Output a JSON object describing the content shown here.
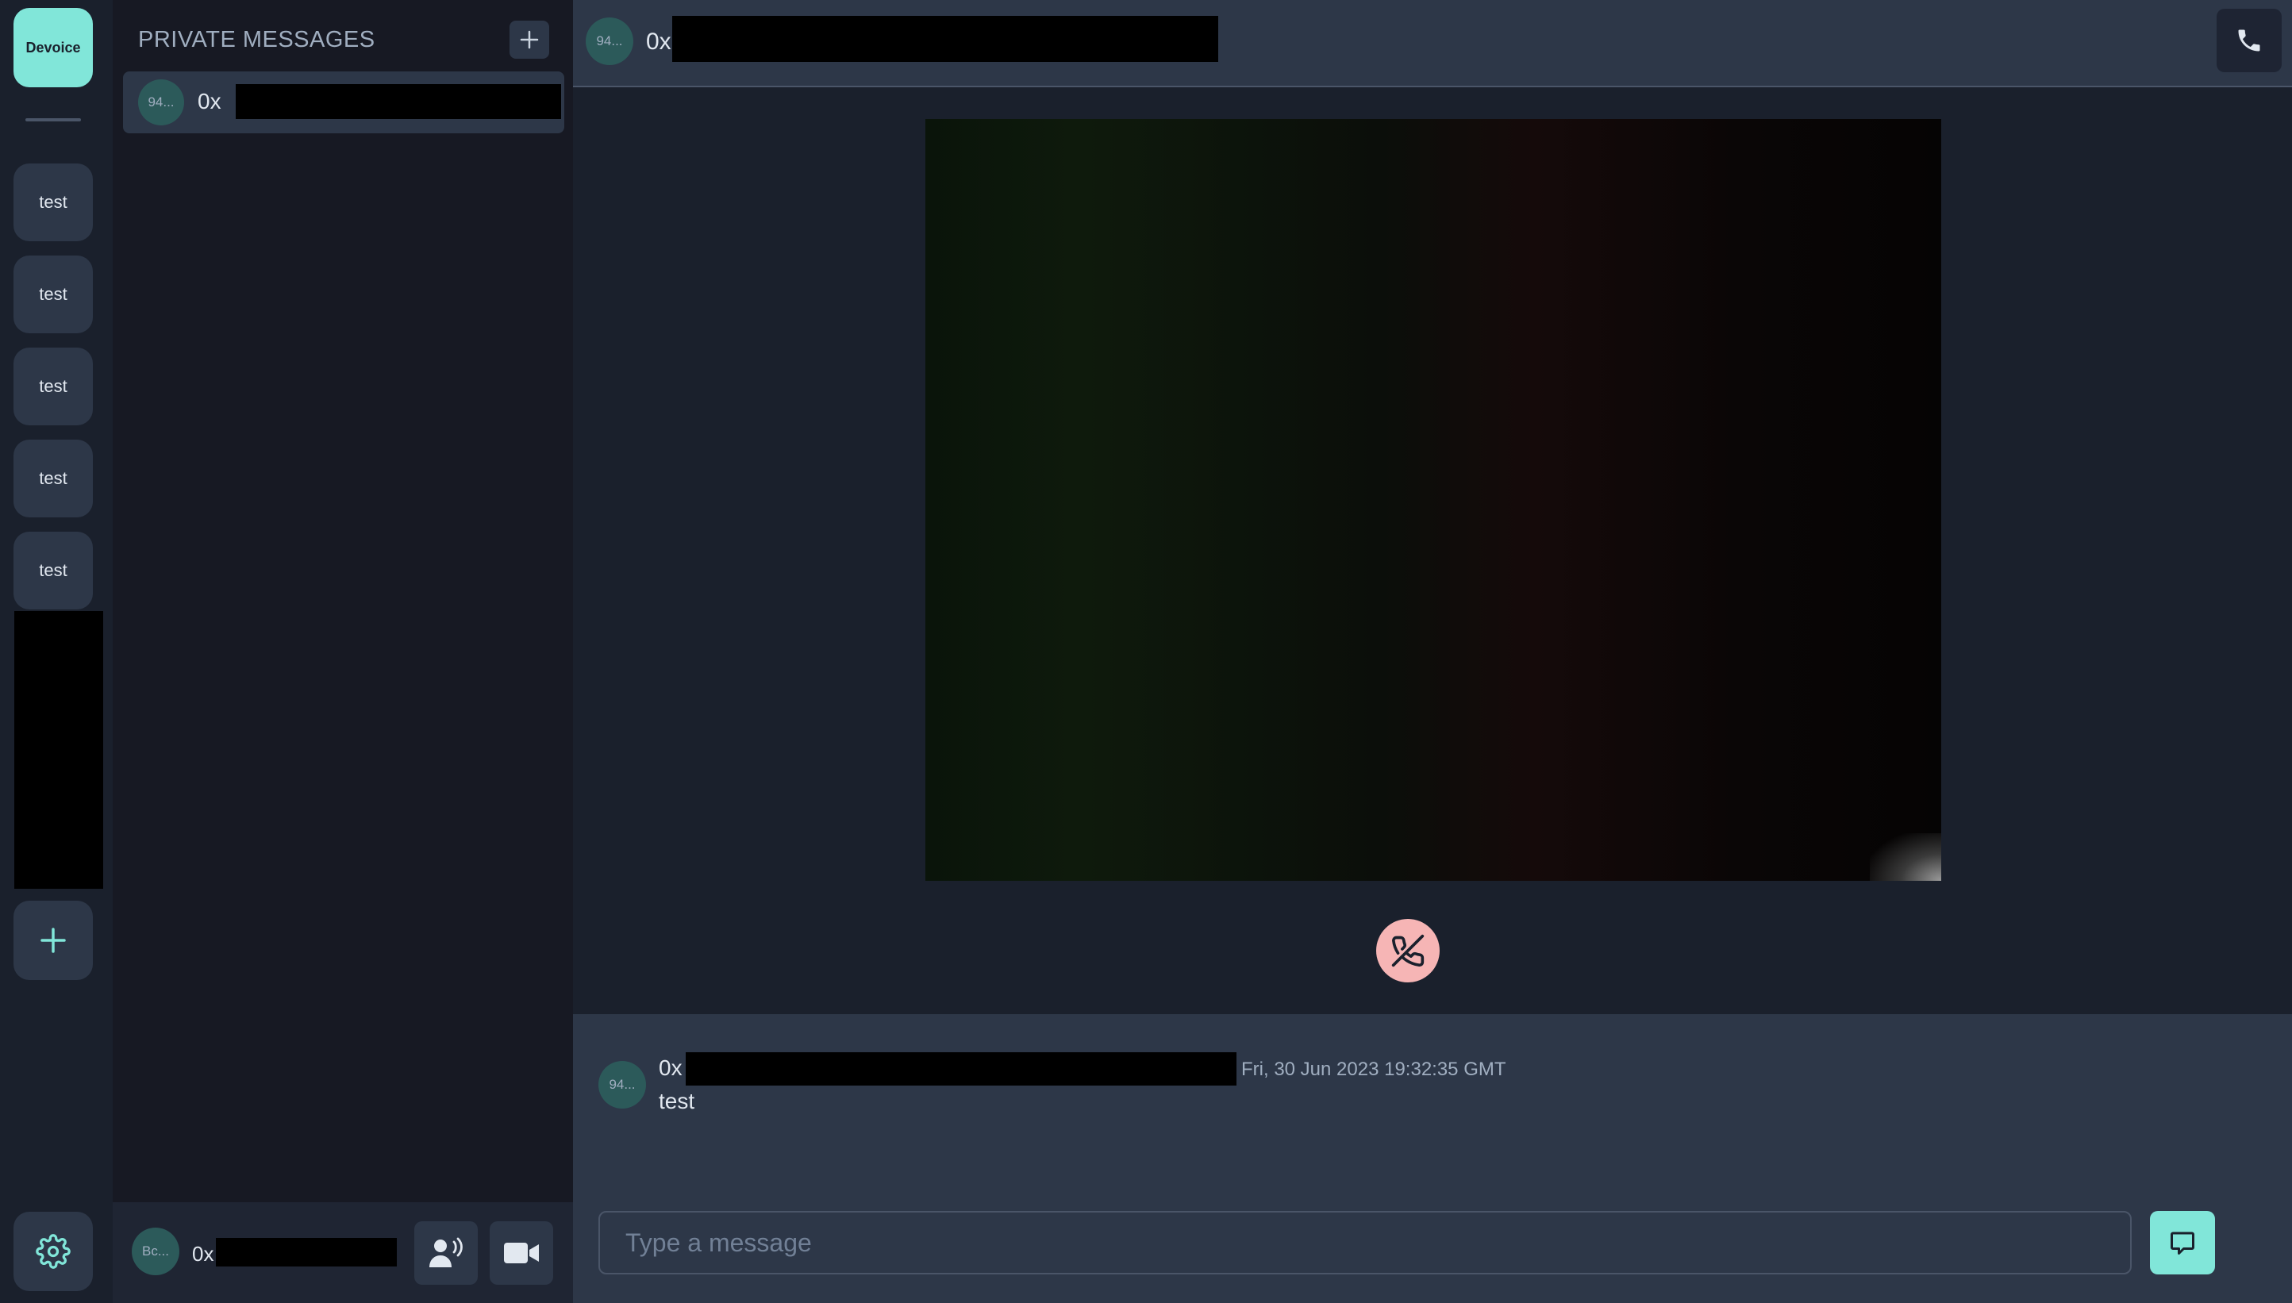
{
  "rail": {
    "logo_label": "Devoice",
    "servers": [
      {
        "label": "test"
      },
      {
        "label": "test"
      },
      {
        "label": "test"
      },
      {
        "label": "test"
      },
      {
        "label": "test"
      }
    ],
    "add_icon": "plus-icon",
    "settings_icon": "gear-icon"
  },
  "dm": {
    "title": "PRIVATE MESSAGES",
    "add_icon": "plus-icon",
    "items": [
      {
        "avatar": "94...",
        "address_prefix": "0x"
      }
    ]
  },
  "user": {
    "avatar": "Bc...",
    "address_prefix": "0x",
    "mic_icon": "speak-icon",
    "video_icon": "video-camera-icon"
  },
  "header": {
    "avatar": "94...",
    "address_prefix": "0x",
    "call_icon": "phone-icon"
  },
  "call": {
    "hangup_icon": "phone-off-icon"
  },
  "messages": [
    {
      "avatar": "94...",
      "author_prefix": "0x",
      "timestamp": "Fri, 30 Jun 2023 19:32:35 GMT",
      "text": "test"
    }
  ],
  "composer": {
    "placeholder": "Type a message",
    "send_icon": "chat-bubble-icon"
  },
  "colors": {
    "accent": "#81e6d9",
    "panel": "#2d3748",
    "background": "#1a202c",
    "hangup": "#f6b5b5"
  }
}
